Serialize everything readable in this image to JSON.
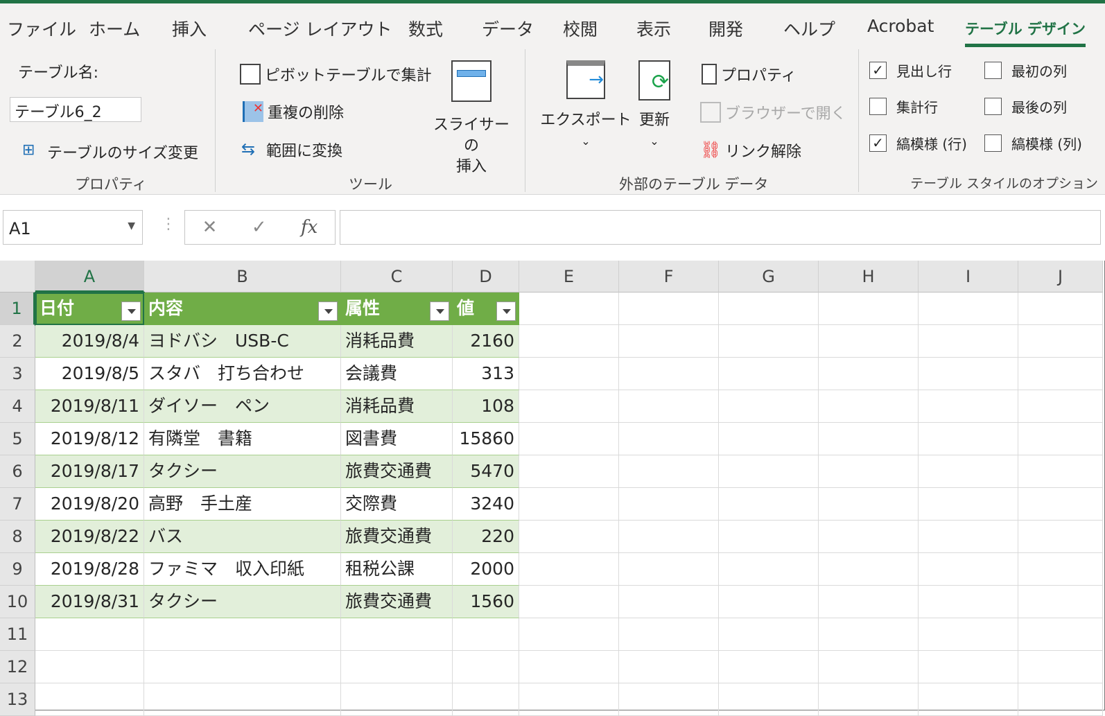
{
  "ribbon": {
    "tabs": [
      "ファイル",
      "ホーム",
      "挿入",
      "ページ レイアウト",
      "数式",
      "データ",
      "校閲",
      "表示",
      "開発",
      "ヘルプ",
      "Acrobat",
      "テーブル デザイン"
    ],
    "active_tab": "テーブル デザイン",
    "properties": {
      "table_name_label": "テーブル名:",
      "table_name_value": "テーブル6_2",
      "resize": "テーブルのサイズ変更",
      "group": "プロパティ"
    },
    "tools": {
      "pivot": "ピボットテーブルで集計",
      "remove_dup": "重複の削除",
      "convert": "範囲に変換",
      "slicer_1": "スライサーの",
      "slicer_2": "挿入",
      "group": "ツール"
    },
    "external": {
      "export": "エクスポート",
      "refresh": "更新",
      "properties": "プロパティ",
      "open_browser": "ブラウザーで開く",
      "unlink": "リンク解除",
      "group": "外部のテーブル データ"
    },
    "style_options": {
      "header_row": "見出し行",
      "header_row_checked": true,
      "total_row": "集計行",
      "total_row_checked": false,
      "banded_rows": "縞模様 (行)",
      "banded_rows_checked": true,
      "first_col": "最初の列",
      "first_col_checked": false,
      "last_col": "最後の列",
      "last_col_checked": false,
      "banded_cols": "縞模様 (列)",
      "banded_cols_checked": false,
      "group": "テーブル スタイルのオプション"
    }
  },
  "formula_bar": {
    "name_box": "A1",
    "cancel": "✕",
    "enter": "✓",
    "fx": "fx",
    "value": ""
  },
  "sheet": {
    "columns": [
      "A",
      "B",
      "C",
      "D",
      "E",
      "F",
      "G",
      "H",
      "I",
      "J"
    ],
    "rows": [
      "1",
      "2",
      "3",
      "4",
      "5",
      "6",
      "7",
      "8",
      "9",
      "10",
      "11",
      "12",
      "13"
    ],
    "table_headers": [
      "日付",
      "内容",
      "属性",
      "値"
    ],
    "table_rows": [
      [
        "2019/8/4",
        "ヨドバシ　USB-C",
        "消耗品費",
        "2160"
      ],
      [
        "2019/8/5",
        "スタバ　打ち合わせ",
        "会議費",
        "313"
      ],
      [
        "2019/8/11",
        "ダイソー　ペン",
        "消耗品費",
        "108"
      ],
      [
        "2019/8/12",
        "有隣堂　書籍",
        "図書費",
        "15860"
      ],
      [
        "2019/8/17",
        "タクシー",
        "旅費交通費",
        "5470"
      ],
      [
        "2019/8/20",
        "高野　手土産",
        "交際費",
        "3240"
      ],
      [
        "2019/8/22",
        "バス",
        "旅費交通費",
        "220"
      ],
      [
        "2019/8/28",
        "ファミマ　収入印紙",
        "租税公課",
        "2000"
      ],
      [
        "2019/8/31",
        "タクシー",
        "旅費交通費",
        "1560"
      ]
    ],
    "colors": {
      "header": "#70ad47",
      "band": "#e2efda",
      "accent": "#217346"
    }
  }
}
